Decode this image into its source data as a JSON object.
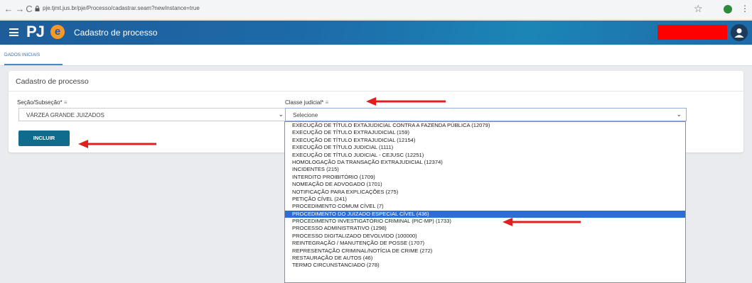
{
  "browser": {
    "url": "pje.tjmt.jus.br/pje/Processo/cadastrar.seam?newInstance=true"
  },
  "app": {
    "logo": "PJ",
    "logo_e": "e",
    "title": "Cadastro de processo"
  },
  "tabs": [
    {
      "label": "DADOS INICIAIS"
    }
  ],
  "form": {
    "title": "Cadastro de processo",
    "secao": {
      "label": "Seção/Subseção*",
      "value": "VÁRZEA GRANDE JUIZADOS"
    },
    "classe": {
      "label": "Classe judicial*",
      "value": "Selecione"
    },
    "submit_label": "INCLUIR",
    "required_mark": "≡"
  },
  "dropdown": {
    "options": [
      "EXECUÇÃO DE TÍTULO EXTAJUDICIAL CONTRA A FAZENDA PÚBLICA (12079)",
      "EXECUÇÃO DE TÍTULO EXTRAJUDICIAL (159)",
      "EXECUÇÃO DE TÍTULO EXTRAJUDICIAL (12154)",
      "EXECUÇÃO DE TÍTULO JUDICIAL (1111)",
      "EXECUÇÃO DE TÍTULO JUDICIAL - CEJUSC (12251)",
      "HOMOLOGAÇÃO DA TRANSAÇÃO EXTRAJUDICIAL (12374)",
      "INCIDENTES (215)",
      "INTERDITO PROIBITÓRIO (1709)",
      "NOMEAÇÃO DE ADVOGADO (1701)",
      "NOTIFICAÇÃO PARA EXPLICAÇÕES (275)",
      "PETIÇÃO CÍVEL (241)",
      "PROCEDIMENTO COMUM CÍVEL (7)",
      "PROCEDIMENTO DO JUIZADO ESPECIAL CÍVEL (436)",
      "PROCEDIMENTO INVESTIGATÓRIO CRIMINAL (PIC-MP) (1733)",
      "PROCESSO ADMINISTRATIVO (1298)",
      "PROCESSO DIGITALIZADO DEVOLVIDO (100000)",
      "REINTEGRAÇÃO / MANUTENÇÃO DE POSSE (1707)",
      "REPRESENTAÇÃO CRIMINAL/NOTÍCIA DE CRIME (272)",
      "RESTAURAÇÃO DE AUTOS (46)",
      "TERMO CIRCUNSTANCIADO (278)"
    ],
    "highlighted_index": 12
  },
  "colors": {
    "header": "#1d6aa8",
    "button": "#0f6c8b",
    "highlight": "#2c6fd1",
    "annotation_arrow": "#e02020"
  }
}
